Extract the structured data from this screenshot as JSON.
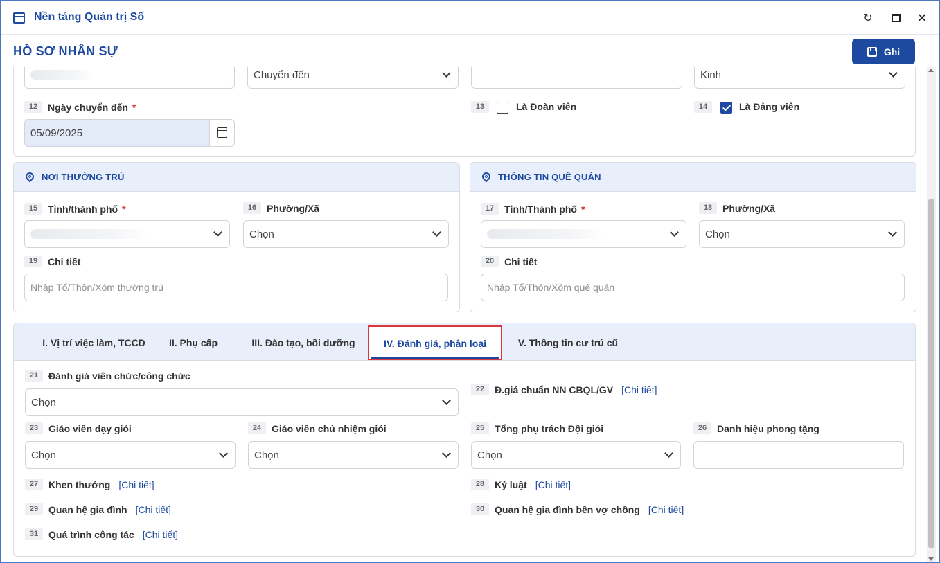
{
  "window": {
    "title": "Nền tảng Quản trị Số"
  },
  "header": {
    "title": "HỒ SƠ NHÂN SỰ",
    "save_label": "Ghi"
  },
  "top_row": {
    "arrival_type": "Chuyển đến",
    "ethnicity": "Kinh"
  },
  "arrival_date": {
    "num": "12",
    "label": "Ngày chuyển đến",
    "value": "05/09/2025"
  },
  "union_member": {
    "num": "13",
    "label": "Là Đoàn viên",
    "checked": false
  },
  "party_member": {
    "num": "14",
    "label": "Là Đảng viên",
    "checked": true
  },
  "residence": {
    "title": "NƠI THƯỜNG TRÚ",
    "province": {
      "num": "15",
      "label": "Tỉnh/thành phố"
    },
    "ward": {
      "num": "16",
      "label": "Phường/Xã",
      "value": "Chọn"
    },
    "detail": {
      "num": "19",
      "label": "Chi tiết",
      "placeholder": "Nhập Tổ/Thôn/Xóm thường trú"
    }
  },
  "hometown": {
    "title": "THÔNG TIN QUÊ QUÁN",
    "province": {
      "num": "17",
      "label": "Tỉnh/Thành phố"
    },
    "ward": {
      "num": "18",
      "label": "Phường/Xã",
      "value": "Chọn"
    },
    "detail": {
      "num": "20",
      "label": "Chi tiết",
      "placeholder": "Nhập Tổ/Thôn/Xóm quê quán"
    }
  },
  "required_mark": "*",
  "tabs": [
    {
      "label": "I. Vị trí việc làm, TCCD"
    },
    {
      "label": "II. Phụ cấp"
    },
    {
      "label": "III. Đào tạo, bồi dưỡng"
    },
    {
      "label": "IV. Đánh giá, phân loại"
    },
    {
      "label": "V. Thông tin cư trú cũ"
    }
  ],
  "evaluation": {
    "detail_link": "[Chi tiết]",
    "f21": {
      "num": "21",
      "label": "Đánh giá viên chức/công chức",
      "value": "Chọn"
    },
    "f22": {
      "num": "22",
      "label": "Đ.giá chuẩn NN CBQL/GV"
    },
    "f23": {
      "num": "23",
      "label": "Giáo viên dạy giỏi",
      "value": "Chọn"
    },
    "f24": {
      "num": "24",
      "label": "Giáo viên chủ nhiệm giỏi",
      "value": "Chọn"
    },
    "f25": {
      "num": "25",
      "label": "Tổng phụ trách Đội giỏi",
      "value": "Chọn"
    },
    "f26": {
      "num": "26",
      "label": "Danh hiệu phong tặng"
    },
    "f27": {
      "num": "27",
      "label": "Khen thưởng"
    },
    "f28": {
      "num": "28",
      "label": "Kỷ luật"
    },
    "f29": {
      "num": "29",
      "label": "Quan hệ gia đình"
    },
    "f30": {
      "num": "30",
      "label": "Quan hệ gia đình bên vợ chồng"
    },
    "f31": {
      "num": "31",
      "label": "Quá trình công tác"
    }
  }
}
